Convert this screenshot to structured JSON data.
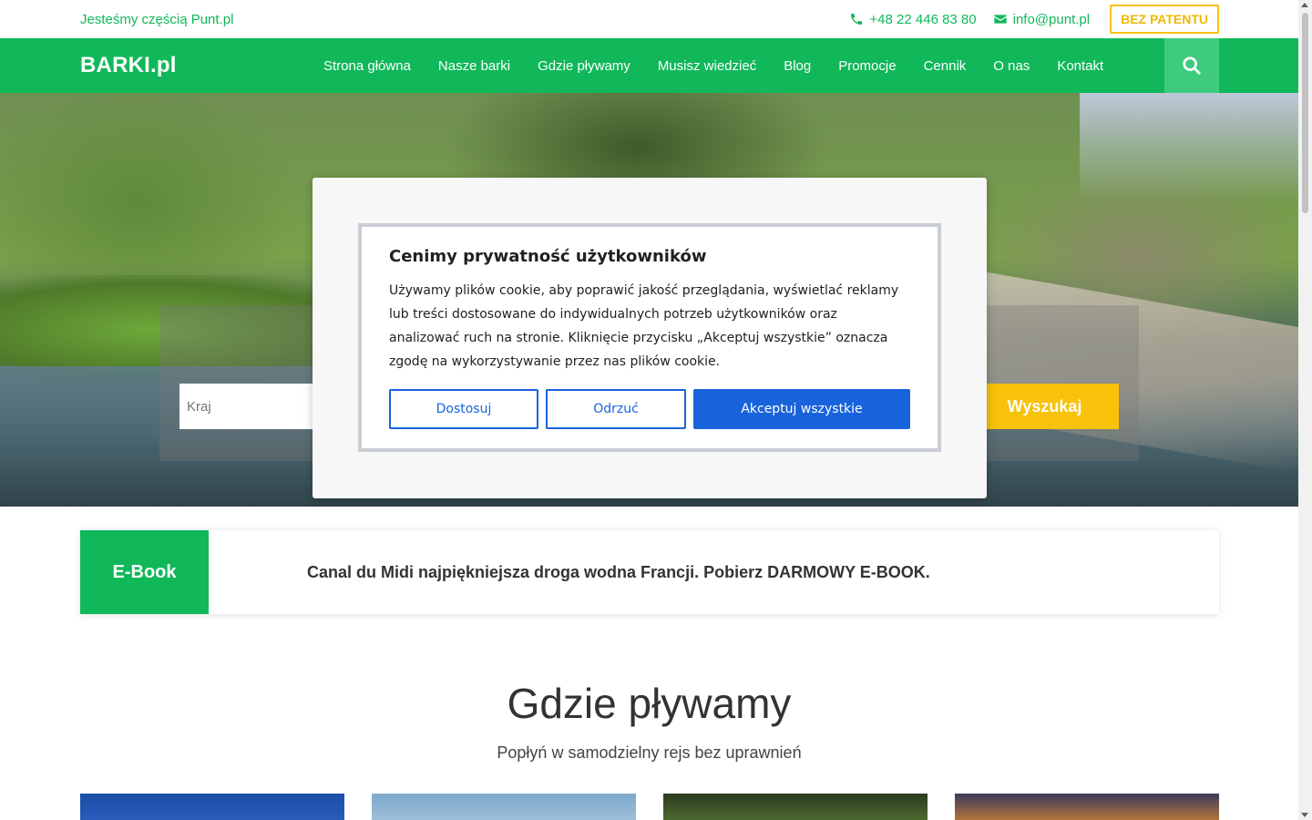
{
  "topbar": {
    "tagline": "Jesteśmy częścią Punt.pl",
    "phone": "+48 22 446 83 80",
    "email": "info@punt.pl",
    "patent_button": "BEZ PATENTU"
  },
  "nav": {
    "logo": "BARKI.pl",
    "items": [
      {
        "label": "Strona główna"
      },
      {
        "label": "Nasze barki"
      },
      {
        "label": "Gdzie pływamy"
      },
      {
        "label": "Musisz wiedzieć"
      },
      {
        "label": "Blog"
      },
      {
        "label": "Promocje"
      },
      {
        "label": "Cennik"
      },
      {
        "label": "O nas"
      },
      {
        "label": "Kontakt"
      }
    ],
    "search_icon": "search-icon"
  },
  "hero": {
    "country_placeholder": "Kraj",
    "search_button": "Wyszukaj"
  },
  "cookie": {
    "title": "Cenimy prywatność użytkowników",
    "text": "Używamy plików cookie, aby poprawić jakość przeglądania, wyświetlać reklamy lub treści dostosowane do indywidualnych potrzeb użytkowników oraz analizować ruch na stronie. Kliknięcie przycisku „Akceptuj wszystkie” oznacza zgodę na wykorzystywanie przez nas plików cookie.",
    "customize": "Dostosuj",
    "reject": "Odrzuć",
    "accept_all": "Akceptuj wszystkie"
  },
  "ebook": {
    "tag": "E-Book",
    "text": "Canal du Midi najpiękniejsza droga wodna Francji. Pobierz DARMOWY E-BOOK."
  },
  "section": {
    "title": "Gdzie pływamy",
    "subtitle": "Popłyń w samodzielny rejs bez uprawnień"
  },
  "colors": {
    "brand_green": "#10b85a",
    "accent_yellow": "#f8c10a",
    "cookie_blue": "#1863dc"
  }
}
